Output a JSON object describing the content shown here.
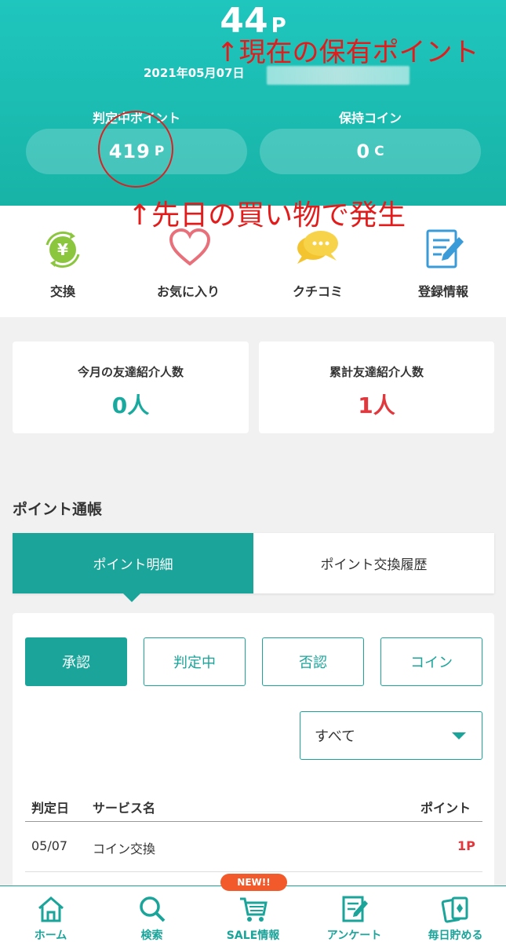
{
  "header": {
    "current_points": "44",
    "current_points_unit": "P",
    "date": "2021年05月07日",
    "pending_label": "判定中ポイント",
    "pending_value": "419",
    "pending_unit": "P",
    "coin_label": "保持コイン",
    "coin_value": "0",
    "coin_unit": "C"
  },
  "annotations": {
    "current_points_note": "↑現在の保有ポイント",
    "pending_note": "↑先日の買い物で発生"
  },
  "menu": [
    {
      "label": "交換",
      "icon": "exchange-yen-icon"
    },
    {
      "label": "お気に入り",
      "icon": "heart-icon"
    },
    {
      "label": "クチコミ",
      "icon": "speech-bubble-icon"
    },
    {
      "label": "登録情報",
      "icon": "edit-document-icon"
    }
  ],
  "stats": {
    "monthly_label": "今月の友達紹介人数",
    "monthly_value": "0人",
    "total_label": "累計友達紹介人数",
    "total_value": "1人"
  },
  "passbook": {
    "title": "ポイント通帳",
    "tabs": [
      "ポイント明細",
      "ポイント交換履歴"
    ],
    "filters": [
      "承認",
      "判定中",
      "否認",
      "コイン"
    ],
    "select_value": "すべて",
    "columns": [
      "判定日",
      "サービス名",
      "ポイント"
    ],
    "rows": [
      {
        "date": "05/07",
        "service": "コイン交換",
        "points": "1P"
      }
    ]
  },
  "nav": {
    "items": [
      "ホーム",
      "検索",
      "SALE情報",
      "アンケート",
      "毎日貯める"
    ],
    "new_badge": "NEW!!"
  },
  "colors": {
    "teal": "#1aa49a",
    "header": "#1fc6bd",
    "red": "#e0383d",
    "annotation": "#e31b1b",
    "badge": "#f25a2c"
  }
}
